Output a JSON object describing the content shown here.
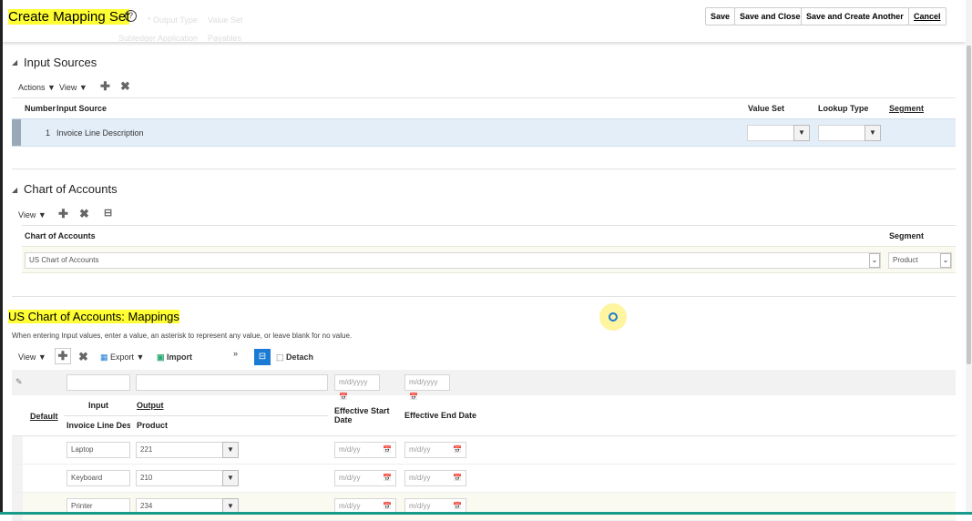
{
  "header": {
    "title": "Create Mapping Set",
    "help_icon": "help-icon",
    "ghost_fields": [
      "* Output Type",
      "Subledger Application"
    ],
    "ghost_values": [
      "Value Set",
      "Payables"
    ],
    "buttons": {
      "save": "Save",
      "save_close": "Save and Close",
      "save_create": "Save and Create Another",
      "cancel": "Cancel"
    }
  },
  "input_sources": {
    "title": "Input Sources",
    "actions": "Actions",
    "view": "View",
    "columns": [
      "Number",
      "Input Source",
      "Value Set",
      "Lookup Type",
      "Segment"
    ],
    "rows": [
      {
        "number": "1",
        "source": "Invoice Line Description",
        "value_set": "",
        "lookup_type": ""
      }
    ]
  },
  "coa": {
    "title": "Chart of Accounts",
    "view": "View",
    "columns": [
      "Chart of Accounts",
      "Segment"
    ],
    "rows": [
      {
        "chart": "US Chart of Accounts",
        "segment": "Product"
      }
    ]
  },
  "mappings": {
    "title": "US Chart of Accounts: Mappings",
    "hint": "When entering Input values, enter a value, an asterisk to represent any value, or leave blank for no value.",
    "toolbar": {
      "view": "View",
      "export": "Export",
      "import": "Import",
      "more": "»",
      "detach": "Detach"
    },
    "filter_date_placeholder": "m/d/yyyy",
    "columns": {
      "default": "Default",
      "input": "Input",
      "output": "Output",
      "input_sub": "Invoice Line Desc",
      "output_sub": "Product",
      "start": "Effective Start Date",
      "end": "Effective End Date"
    },
    "date_placeholder": "m/d/yy",
    "rows": [
      {
        "input": "Laptop",
        "output": "221"
      },
      {
        "input": "Keyboard",
        "output": "210"
      },
      {
        "input": "Printer",
        "output": "234"
      }
    ]
  },
  "colors": {
    "highlight": "#ffff33",
    "selected_row": "#e4eef9",
    "accent": "#1a7ad4"
  }
}
